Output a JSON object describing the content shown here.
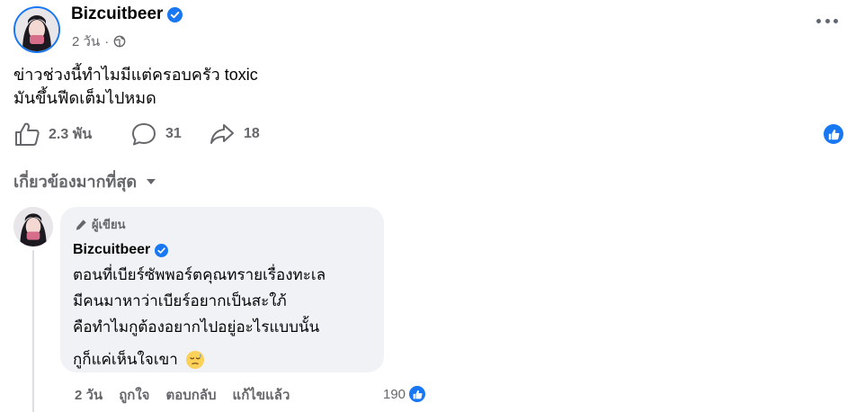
{
  "post": {
    "author": "Bizcuitbeer",
    "time": "2 วัน",
    "separator": "·",
    "text_lines": [
      "ข่าวช่วงนี้ทำไมมีแต่ครอบครัว toxic",
      "มันขึ้นฟีดเต็มไปหมด"
    ],
    "likes": "2.3 พัน",
    "comments": "31",
    "shares": "18"
  },
  "filter": {
    "label": "เกี่ยวข้องมากที่สุด"
  },
  "comment": {
    "badge": "ผู้เขียน",
    "author": "Bizcuitbeer",
    "lines": [
      "ตอนที่เบียร์ซัพพอร์ตคุณทรายเรื่องทะเล",
      "มีคนมาหาว่าเบียร์อยากเป็นสะใภ้",
      "คือทำไมกูต้องอยากไปอยู่อะไรแบบนั้น"
    ],
    "last_line": "กูก็แค่เห็นใจเขา",
    "time": "2 วัน",
    "like_label": "ถูกใจ",
    "reply_label": "ตอบกลับ",
    "edited_label": "แก้ไขแล้ว",
    "reactions": "190"
  },
  "icons": {
    "verified": "verified-badge-icon",
    "globe": "globe-icon",
    "more": "more-horizontal-icon",
    "like": "thumbs-up-icon",
    "comment": "comment-bubble-icon",
    "share": "share-arrow-icon",
    "author_badge": "pen-icon",
    "dropdown": "caret-down-icon",
    "emoji": "downcast-face-emoji-icon"
  },
  "colors": {
    "accent": "#1877f2",
    "secondary_text": "#65676b",
    "bubble": "#f0f2f5"
  }
}
